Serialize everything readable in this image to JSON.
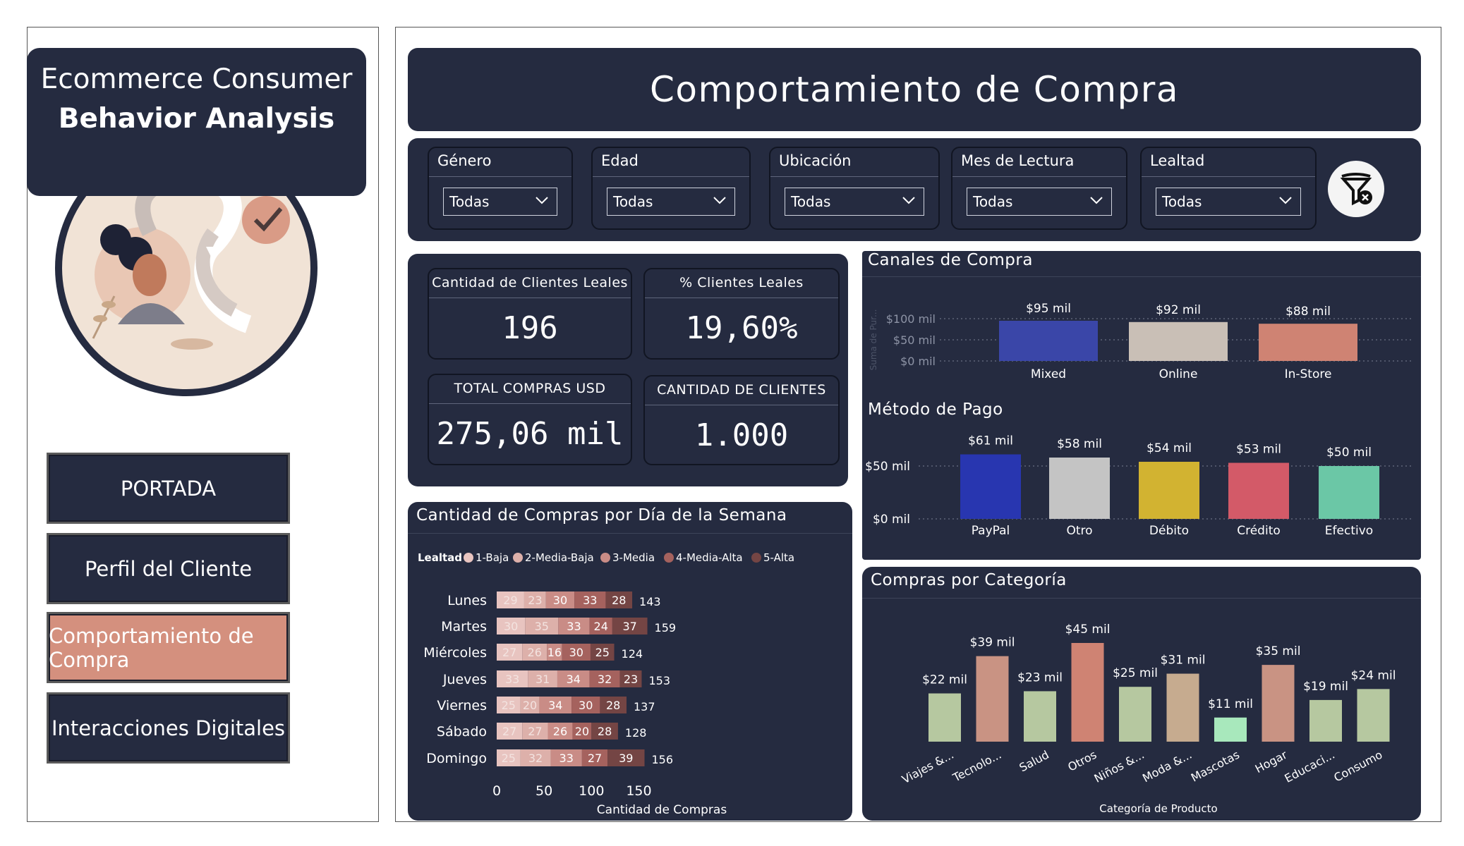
{
  "brand": {
    "line1": "Ecommerce Consumer",
    "line2": "Behavior Analysis"
  },
  "nav": [
    {
      "label": "PORTADA",
      "active": false
    },
    {
      "label": "Perfil del Cliente",
      "active": false
    },
    {
      "label": "Comportamiento de Compra",
      "active": true
    },
    {
      "label": "Interacciones Digitales",
      "active": false
    }
  ],
  "header": {
    "title": "Comportamiento de Compra"
  },
  "filters": [
    {
      "label": "Género",
      "value": "Todas"
    },
    {
      "label": "Edad",
      "value": "Todas"
    },
    {
      "label": "Ubicación",
      "value": "Todas"
    },
    {
      "label": "Mes de Lectura",
      "value": "Todas"
    },
    {
      "label": "Lealtad",
      "value": "Todas"
    }
  ],
  "kpis": [
    {
      "title": "Cantidad de Clientes Leales",
      "value": "196"
    },
    {
      "title": "% Clientes Leales",
      "value": "19,60%"
    },
    {
      "title": "TOTAL COMPRAS USD",
      "value": "275,06 mil"
    },
    {
      "title": "CANTIDAD DE CLIENTES",
      "value": "1.000"
    }
  ],
  "colors": {
    "panel": "#252b40",
    "accent": "#d4907e",
    "loyalty": [
      "#e8c4c0",
      "#ddb0aa",
      "#c98c86",
      "#a5625e",
      "#744544"
    ],
    "channels": [
      "#3a46a8",
      "#c9bfb6",
      "#cf8373"
    ],
    "payments": [
      "#2836b0",
      "#c4c4c4",
      "#d2b331",
      "#d35a68",
      "#6bc7a6"
    ],
    "categories": [
      "#b6c8a0",
      "#c99383",
      "#b6c8a0",
      "#cf8373",
      "#b6c8a0",
      "#c6ab8f",
      "#a8e8bc",
      "#c99383",
      "#b6c8a0",
      "#b6c8a0"
    ]
  },
  "chart_data": [
    {
      "type": "bar",
      "title": "Canales de Compra",
      "ylabel": "Suma de Pur...",
      "yticks": [
        "$100 mil",
        "$50 mil",
        "$0 mil"
      ],
      "ylim": [
        0,
        100
      ],
      "categories": [
        "Mixed",
        "Online",
        "In-Store"
      ],
      "values": [
        95,
        92,
        88
      ],
      "labels": [
        "$95 mil",
        "$92 mil",
        "$88 mil"
      ]
    },
    {
      "type": "bar",
      "title": "Método de Pago",
      "yticks": [
        "$50 mil",
        "$0 mil"
      ],
      "ylim": [
        0,
        65
      ],
      "categories": [
        "PayPal",
        "Otro",
        "Débito",
        "Crédito",
        "Efectivo"
      ],
      "values": [
        61,
        58,
        54,
        53,
        50
      ],
      "labels": [
        "$61 mil",
        "$58 mil",
        "$54 mil",
        "$53 mil",
        "$50 mil"
      ]
    },
    {
      "type": "bar",
      "orientation": "horizontal-stacked",
      "title": "Cantidad de Compras por Día de la Semana",
      "legend_title": "Lealtad",
      "xlabel": "Cantidad de Compras",
      "xticks": [
        0,
        50,
        100,
        150
      ],
      "xlim": [
        0,
        165
      ],
      "categories": [
        "Lunes",
        "Martes",
        "Miércoles",
        "Jueves",
        "Viernes",
        "Sábado",
        "Domingo"
      ],
      "series": [
        {
          "name": "1-Baja",
          "values": [
            29,
            30,
            27,
            33,
            25,
            27,
            25
          ]
        },
        {
          "name": "2-Media-Baja",
          "values": [
            23,
            35,
            26,
            31,
            20,
            27,
            32
          ]
        },
        {
          "name": "3-Media",
          "values": [
            30,
            33,
            16,
            34,
            34,
            26,
            33
          ]
        },
        {
          "name": "4-Media-Alta",
          "values": [
            33,
            24,
            30,
            32,
            30,
            20,
            27
          ]
        },
        {
          "name": "5-Alta",
          "values": [
            28,
            37,
            25,
            23,
            28,
            28,
            39
          ]
        }
      ],
      "totals": [
        143,
        159,
        124,
        153,
        137,
        128,
        156
      ]
    },
    {
      "type": "bar",
      "title": "Compras por Categoría",
      "xlabel": "Categoría de Producto",
      "ylim": [
        0,
        50
      ],
      "categories": [
        "Viajes &...",
        "Tecnolo...",
        "Salud",
        "Otros",
        "Niños &...",
        "Moda &...",
        "Mascotas",
        "Hogar",
        "Educaci...",
        "Consumo"
      ],
      "values": [
        22,
        39,
        23,
        45,
        25,
        31,
        11,
        35,
        19,
        24
      ],
      "labels": [
        "$22 mil",
        "$39 mil",
        "$23 mil",
        "$45 mil",
        "$25 mil",
        "$31 mil",
        "$11 mil",
        "$35 mil",
        "$19 mil",
        "$24 mil"
      ]
    }
  ]
}
